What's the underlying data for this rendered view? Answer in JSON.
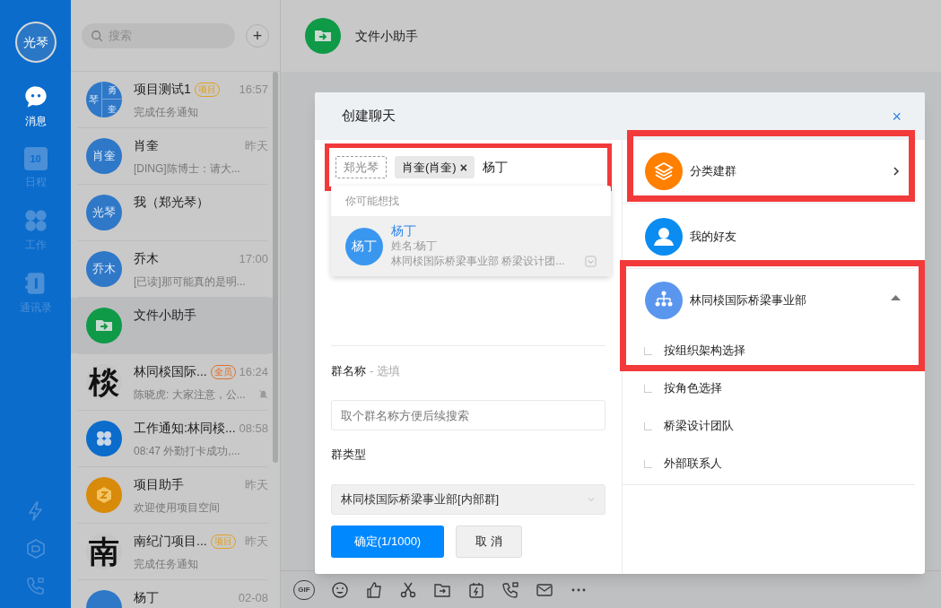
{
  "profile": {
    "avatar": "光琴"
  },
  "nav": [
    {
      "kind": "chat",
      "label": "消息",
      "selected": true
    },
    {
      "kind": "calendar",
      "label": "日程",
      "date": "10",
      "selected": false
    },
    {
      "kind": "work",
      "label": "工作",
      "selected": false
    },
    {
      "kind": "contacts",
      "label": "通讯录",
      "selected": false
    }
  ],
  "nav_tools": [
    {
      "kind": "bolt"
    },
    {
      "kind": "cube"
    },
    {
      "kind": "call"
    }
  ],
  "search": {
    "placeholder": "搜索",
    "add": "+"
  },
  "chats": [
    {
      "kind": "group",
      "avatar_parts": [
        "琴",
        "勇",
        "奎"
      ],
      "name": "项目测试1",
      "tag": {
        "label": "项目",
        "color": "#e0a020"
      },
      "time": "16:57",
      "preview": "完成任务通知",
      "muted": false,
      "selected": false
    },
    {
      "kind": "text",
      "avatar_text": "肖奎",
      "name": "肖奎",
      "time": "昨天",
      "preview": "[DING]陈博士：请大...",
      "muted": false,
      "selected": false
    },
    {
      "kind": "text",
      "avatar_text": "光琴",
      "name": "我（郑光琴）",
      "muted": false,
      "selected": false
    },
    {
      "kind": "text",
      "avatar_text": "乔木",
      "name": "乔木",
      "time": "17:00",
      "preview": "[已读]那可能真的是明...",
      "muted": false,
      "selected": false
    },
    {
      "kind": "folder",
      "name": "文件小助手",
      "muted": false,
      "selected": true
    },
    {
      "kind": "glyph",
      "avatar_text": "棪",
      "name": "林同棪国际...",
      "tag": {
        "label": "全员",
        "color": "#e0702a"
      },
      "time": "16:24",
      "preview": "陈晓虎: 大家注意，公...",
      "muted": true,
      "selected": false
    },
    {
      "kind": "clover",
      "name": "工作通知:林同棪...",
      "time": "08:58",
      "preview": "08:47 外勤打卡成功,...",
      "muted": false,
      "selected": false
    },
    {
      "kind": "hex",
      "name": "项目助手",
      "time": "昨天",
      "preview": "欢迎使用项目空间",
      "muted": false,
      "selected": false
    },
    {
      "kind": "glyph",
      "avatar_text": "南",
      "name": "南纪门项目...",
      "tag": {
        "label": "项目",
        "color": "#e0a020"
      },
      "time": "昨天",
      "preview": "完成任务通知",
      "muted": false,
      "selected": false
    },
    {
      "kind": "blank",
      "name": "杨丁",
      "time": "02-08",
      "muted": false,
      "selected": false
    }
  ],
  "conversation": {
    "title": "文件小助手"
  },
  "toolbar": [
    {
      "kind": "gif",
      "label": "GIF"
    },
    {
      "kind": "emoji"
    },
    {
      "kind": "thumb"
    },
    {
      "kind": "scissors"
    },
    {
      "kind": "folder"
    },
    {
      "kind": "flash"
    },
    {
      "kind": "call"
    },
    {
      "kind": "mail"
    },
    {
      "kind": "more"
    }
  ],
  "dialog": {
    "title": "创建聊天",
    "close": "×",
    "selector": {
      "highlighted": true,
      "chips": [
        {
          "kind": "fixed",
          "label": "郑光琴"
        },
        {
          "kind": "removable",
          "label": "肖奎(肖奎)",
          "remove": "×"
        }
      ],
      "value": "杨丁"
    },
    "suggestions": {
      "heading": "你可能想找",
      "items": [
        {
          "avatar": "杨丁",
          "name": "杨丁",
          "alias": "姓名:杨丁",
          "dept": "林同棪国际桥梁事业部 桥梁设计团...",
          "selected": true
        }
      ]
    },
    "group_name": {
      "label": "群名称",
      "hint": "- 选填",
      "placeholder": "取个群名称方便后续搜索"
    },
    "group_type": {
      "label": "群类型",
      "value": "林同棪国际桥梁事业部[内部群]"
    },
    "buttons": [
      {
        "kind": "primary",
        "label": "确定(1/1000)"
      },
      {
        "kind": "default",
        "label": "取 消"
      }
    ],
    "sources": [
      {
        "kind": "category",
        "label": "分类建群",
        "highlighted": true
      },
      {
        "kind": "friends",
        "label": "我的好友",
        "highlighted": false
      },
      {
        "kind": "org",
        "label": "林同棪国际桥梁事业部",
        "expanded": true,
        "highlighted": true,
        "children": [
          {
            "label": "按组织架构选择"
          },
          {
            "label": "按角色选择"
          },
          {
            "label": "桥梁设计团队"
          },
          {
            "label": "外部联系人"
          }
        ]
      }
    ]
  }
}
